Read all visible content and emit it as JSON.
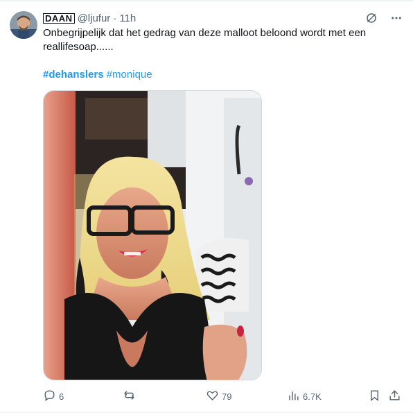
{
  "tweet": {
    "display_name": "DAAN",
    "handle": "@ljufur",
    "separator": "·",
    "time": "11h",
    "text": "Onbegrijpelijk dat het gedrag van deze malloot beloond wordt met een\nreallifesoap......",
    "hashtags": [
      "#dehanslers",
      "#monique"
    ]
  },
  "actions": {
    "reply_count": "6",
    "retweet_count": "",
    "like_count": "79",
    "views_count": "6.7K"
  },
  "icons": {
    "grok": "grok-icon",
    "more": "more-dots-icon",
    "reply": "reply-icon",
    "retweet": "retweet-icon",
    "like": "heart-icon",
    "views": "views-icon",
    "bookmark": "bookmark-icon",
    "share": "share-icon"
  },
  "colors": {
    "link": "#1d9bf0",
    "secondary_text": "#536471",
    "primary_text": "#0f1419"
  }
}
